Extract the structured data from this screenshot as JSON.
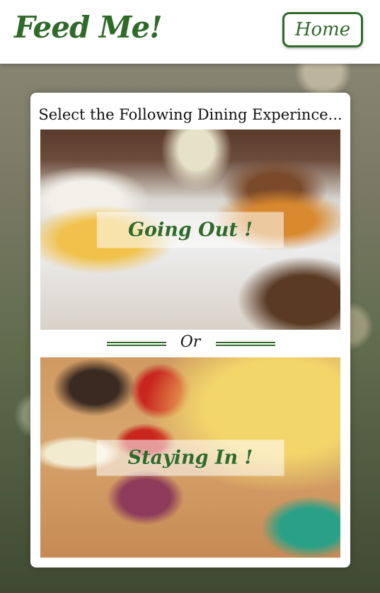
{
  "header": {
    "logo_text": "Feed Me!",
    "home_label": "Home"
  },
  "card": {
    "title": "Select the Following Dining Experince...",
    "options": [
      {
        "label": "Going Out !"
      },
      {
        "label": "Staying In !"
      }
    ],
    "divider_text": "Or"
  },
  "colors": {
    "brand_green": "#2f6a2a",
    "header_bg": "#ffffff",
    "card_bg": "#ffffff"
  }
}
